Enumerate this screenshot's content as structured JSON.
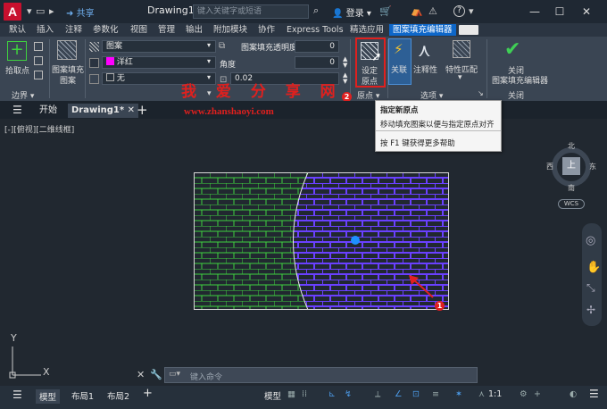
{
  "app": {
    "logo": "A",
    "share": "共享",
    "doc_title": "Drawing1.dwg",
    "search_placeholder": "键入关键字或短语",
    "login": "登录",
    "help": "?"
  },
  "menu_tabs": [
    "默认",
    "插入",
    "注释",
    "参数化",
    "视图",
    "管理",
    "输出",
    "附加模块",
    "协作",
    "Express Tools",
    "精选应用",
    "图案填充编辑器"
  ],
  "ribbon": {
    "pick_points": "拾取点",
    "hatch_pattern": "图案填充",
    "pattern_sub": "图案",
    "boundary_panel": "边界",
    "type_value": "图案",
    "color_value": "洋红",
    "bg_value": "无",
    "transparency_label": "图案填充透明度",
    "transparency_value": "0",
    "angle_label": "角度",
    "angle_value": "0",
    "scale_value": "0.02",
    "set_origin_1": "设定",
    "set_origin_2": "原点",
    "origin_panel": "原点",
    "associative": "关联",
    "annotative": "注释性",
    "match_props": "特性匹配",
    "options_panel": "选项",
    "close_1": "关闭",
    "close_2": "图案填充编辑器",
    "close_panel": "关闭"
  },
  "file_tabs": {
    "start": "开始",
    "drawing": "Drawing1*"
  },
  "tooltip": {
    "title": "指定新原点",
    "desc": "移动填充图案以便与指定原点对齐",
    "help": "按 F1 键获得更多帮助"
  },
  "view_label": "[-][俯视][二维线框]",
  "watermark": {
    "cn": "我 爱 分 享 网",
    "url": "www.zhanshaoyi.com"
  },
  "viewcube": {
    "north": "北",
    "south": "南",
    "east": "东",
    "west": "西",
    "top": "上",
    "wcs": "WCS"
  },
  "ucs": {
    "x": "X",
    "y": "Y"
  },
  "command": {
    "placeholder": "键入命令"
  },
  "status": {
    "model_tab": "模型",
    "layout1": "布局1",
    "layout2": "布局2",
    "model_btn": "模型",
    "scale": "1:1"
  },
  "markers": {
    "one": "1",
    "two": "2"
  },
  "colors": {
    "accent": "#0e67c9",
    "hatch_green": "#3fd23f",
    "hatch_blue": "#6a40ff",
    "marker_red": "#e02020"
  }
}
